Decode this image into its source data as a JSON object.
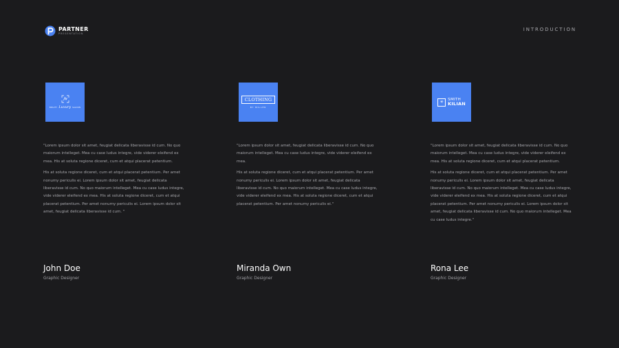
{
  "brand": {
    "name": "PARTNER",
    "tagline": "PRESENTATION"
  },
  "section_label": "INTRODUCTION",
  "cards": [
    {
      "logo": {
        "line1": "BEAUTY",
        "line2": "Luxury",
        "line3": "SALOON"
      },
      "quote_p1": "\"Lorem ipsum dolor sit amet, feugiat delicata liberavisse id cum. No quo maiorum intelleget. Mea cu case ludus integre, vide viderer eleifend ex mea. His at soluta regione diceret, cum et atqui placerat petentium.",
      "quote_p2": "His at soluta regione diceret, cum et atqui placerat petentium. Per amet nonumy periculis ei. Lorem ipsum dolor sit amet, feugiat delicata liberavisse id cum. No quo maiorum intelleget. Mea cu case ludus integre, vide viderer eleifend ex mea. His at soluta regione diceret, cum et atqui placerat petentium. Per amet nonumy periculis ei. Lorem ipsum dolor sit amet, feugiat delicata liberavisse id cum. \"",
      "name": "John Doe",
      "role": "Graphic Designer"
    },
    {
      "logo": {
        "line1": "CLOTHING",
        "line2": "BY MILLER"
      },
      "quote_p1": "\"Lorem ipsum dolor sit amet, feugiat delicata liberavisse id cum. No quo maiorum intelleget. Mea cu case ludus integre, vide viderer eleifend ex mea.",
      "quote_p2": "His at soluta regione diceret, cum et atqui placerat petentium. Per amet nonumy periculis ei. Lorem ipsum dolor sit amet, feugiat delicata liberavisse id cum. No quo maiorum intelleget. Mea cu case ludus integre, vide viderer eleifend ex mea. His at soluta regione diceret, cum et atqui placerat petentium. Per amet nonumy periculis ei.\"",
      "name": "Miranda Own",
      "role": "Graphic Designer"
    },
    {
      "logo": {
        "line1": "SMITH",
        "line2": "KILIAN"
      },
      "quote_p1": "\"Lorem ipsum dolor sit amet, feugiat delicata liberavisse id cum. No quo maiorum intelleget. Mea cu case ludus integre, vide viderer eleifend ex mea. His at soluta regione diceret, cum et atqui placerat petentium.",
      "quote_p2": "His at soluta regione diceret, cum et atqui placerat petentium. Per amet nonumy periculis ei. Lorem ipsum dolor sit amet, feugiat delicata liberavisse id cum. No quo maiorum intelleget. Mea cu case ludus integre, vide viderer eleifend ex mea. His at soluta regione diceret, cum et atqui placerat petentium. Per amet nonumy periculis ei. Lorem ipsum dolor sit amet, feugiat delicata liberavisse id cum. No quo maiorum intelleget. Mea cu case ludus integre.\"",
      "name": "Rona Lee",
      "role": "Graphic Designer"
    }
  ],
  "colors": {
    "background": "#1b1b1d",
    "accent": "#4a82f2"
  }
}
